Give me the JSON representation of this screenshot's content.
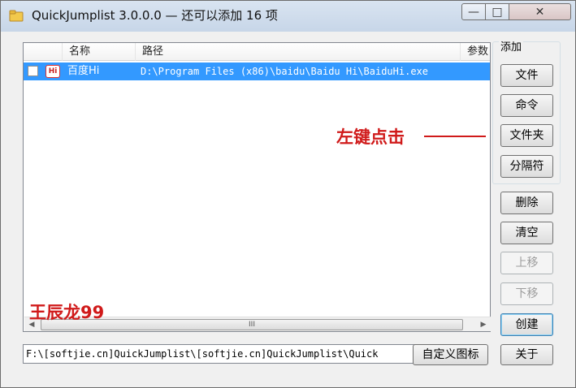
{
  "window": {
    "title": "QuickJumplist 3.0.0.0 — 还可以添加 16 项",
    "controls": {
      "minimize": "—",
      "maximize": "□",
      "close": "✕"
    }
  },
  "list": {
    "columns": [
      "名称",
      "路径",
      "参数"
    ],
    "rows": [
      {
        "checked": false,
        "icon": "baidu-hi-icon",
        "icon_text": "Hi",
        "name": "百度Hi",
        "path": "D:\\Program Files (x86)\\baidu\\Baidu Hi\\BaiduHi.exe"
      }
    ],
    "scroll_thumb_grip": "III"
  },
  "path_field": {
    "value": "F:\\[softjie.cn]QuickJumplist\\[softjie.cn]QuickJumplist\\Quick"
  },
  "add_group": {
    "label": "添加",
    "file_button": "文件",
    "command_button": "命令",
    "folder_button": "文件夹",
    "separator_button": "分隔符"
  },
  "actions": {
    "delete_button": "删除",
    "clear_button": "清空",
    "move_up_button": "上移",
    "move_down_button": "下移",
    "create_button": "创建",
    "custom_icon_button": "自定义图标",
    "close_button": "关于"
  },
  "annotations": {
    "left_click_hint": "左键点击",
    "author_watermark": "王辰龙99"
  },
  "colors": {
    "selection": "#3399ff",
    "annotation": "#d01a1a"
  }
}
